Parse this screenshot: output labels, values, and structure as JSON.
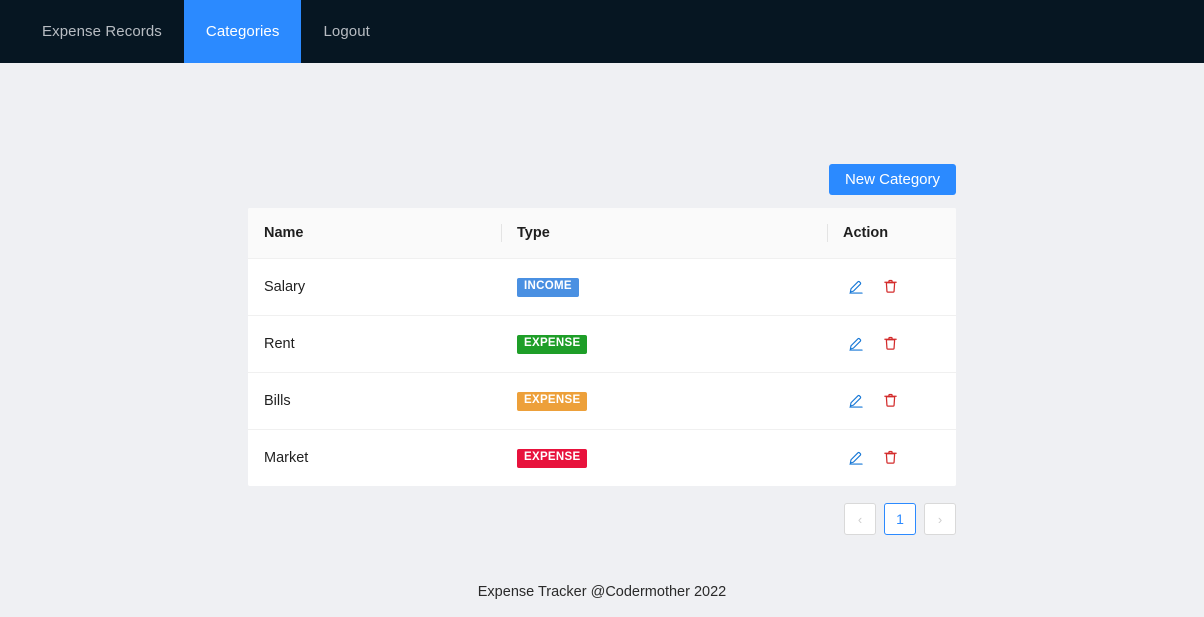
{
  "navbar": {
    "items": [
      {
        "label": "Expense Records",
        "active": false
      },
      {
        "label": "Categories",
        "active": true
      },
      {
        "label": "Logout",
        "active": false
      }
    ]
  },
  "toolbar": {
    "new_category_label": "New Category"
  },
  "table": {
    "columns": [
      "Name",
      "Type",
      "Action"
    ],
    "rows": [
      {
        "name": "Salary",
        "type_label": "INCOME",
        "type_color": "#4a90e2",
        "edit_icon": "pencil-icon",
        "delete_icon": "trash-icon"
      },
      {
        "name": "Rent",
        "type_label": "EXPENSE",
        "type_color": "#1e9e28",
        "edit_icon": "pencil-icon",
        "delete_icon": "trash-icon"
      },
      {
        "name": "Bills",
        "type_label": "EXPENSE",
        "type_color": "#eda03a",
        "edit_icon": "pencil-icon",
        "delete_icon": "trash-icon"
      },
      {
        "name": "Market",
        "type_label": "EXPENSE",
        "type_color": "#e8123c",
        "edit_icon": "pencil-icon",
        "delete_icon": "trash-icon"
      }
    ]
  },
  "pagination": {
    "prev_label": "‹",
    "next_label": "›",
    "pages": [
      "1"
    ],
    "current": "1"
  },
  "footer": {
    "text": "Expense Tracker @Codermother 2022"
  },
  "colors": {
    "navbar_bg": "#061622",
    "accent": "#2b8aff",
    "page_bg": "#eff0f3",
    "edit_icon": "#1677d6",
    "delete_icon": "#d32b2b"
  }
}
